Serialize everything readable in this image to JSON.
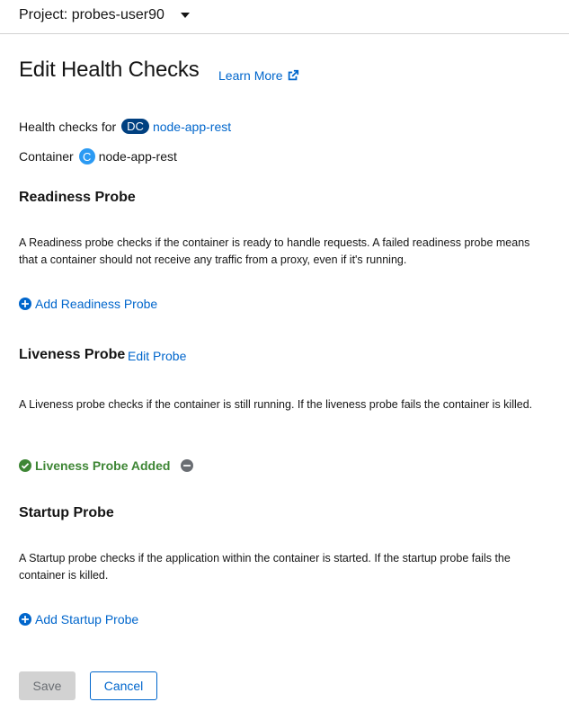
{
  "project": {
    "label": "Project: probes-user90"
  },
  "header": {
    "title": "Edit Health Checks",
    "learn_more": "Learn More"
  },
  "meta": {
    "health_checks_for_label": "Health checks for",
    "resource_badge": "DC",
    "resource_name": "node-app-rest",
    "container_label": "Container",
    "container_badge": "C",
    "container_name": "node-app-rest"
  },
  "readiness": {
    "title": "Readiness Probe",
    "description": "A Readiness probe checks if the container is ready to handle requests. A failed readiness probe means that a container should not receive any traffic from a proxy, even if it's running.",
    "action": "Add Readiness Probe"
  },
  "liveness": {
    "title": "Liveness Probe",
    "edit": "Edit Probe",
    "description": "A Liveness probe checks if the container is still running. If the liveness probe fails the container is killed.",
    "status": "Liveness Probe Added"
  },
  "startup": {
    "title": "Startup Probe",
    "description": "A Startup probe checks if the application within the container is started. If the startup probe fails the container is killed.",
    "action": "Add Startup Probe"
  },
  "footer": {
    "save": "Save",
    "cancel": "Cancel"
  },
  "colors": {
    "link": "#0066cc",
    "success": "#3e8635",
    "badge_dc": "#004080",
    "badge_c": "#2b9af3"
  },
  "icons": [
    "caret-down-icon",
    "external-link-icon",
    "plus-circle-icon",
    "check-circle-icon",
    "minus-circle-icon"
  ]
}
